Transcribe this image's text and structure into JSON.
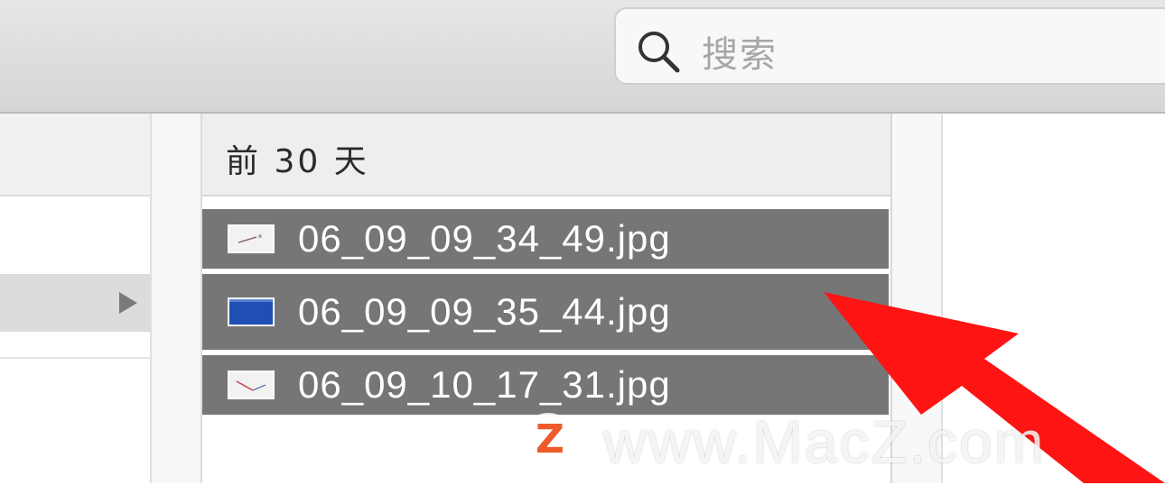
{
  "toolbar": {
    "search": {
      "placeholder": "搜索",
      "icon": "magnifier-icon"
    }
  },
  "sidebar": {
    "selected_row_icon": "disclosure-triangle-icon"
  },
  "file_list": {
    "section_header": "前 30 天",
    "items": [
      {
        "name": "06_09_09_34_49.jpg",
        "thumbnail": "screenshot-thumbnail-light",
        "selected": true
      },
      {
        "name": "06_09_09_35_44.jpg",
        "thumbnail": "screenshot-thumbnail-blue",
        "selected": true
      },
      {
        "name": "06_09_10_17_31.jpg",
        "thumbnail": "screenshot-thumbnail-light",
        "selected": true
      }
    ]
  },
  "watermark": {
    "logo": "Z",
    "text": "www.MacZ.com"
  },
  "colors": {
    "selection": "#767676",
    "arrow": "#ff1a1a",
    "watermark_logo": "#ef5a2b"
  }
}
